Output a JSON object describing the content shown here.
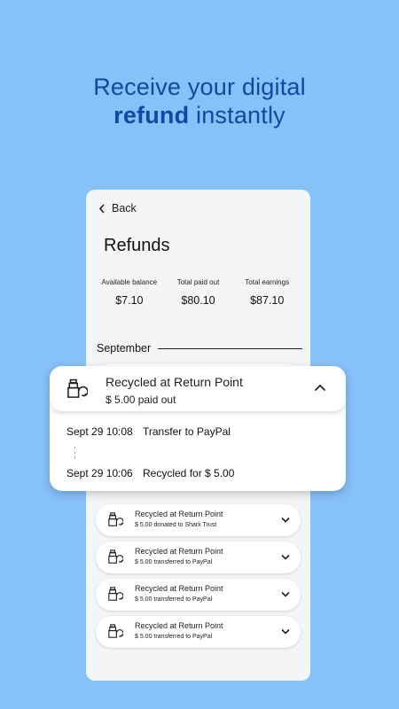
{
  "headline": {
    "line1": "Receive your digital",
    "strong": "refund",
    "rest": " instantly"
  },
  "app": {
    "back_label": "Back",
    "title": "Refunds",
    "stats": [
      {
        "label": "Available balance",
        "value": "$7.10"
      },
      {
        "label": "Total paid out",
        "value": "$80.10"
      },
      {
        "label": "Total earnings",
        "value": "$87.10"
      }
    ],
    "month": "September",
    "expanded": {
      "title": "Recycled at Return Point",
      "subtitle": "$ 5.00 paid out",
      "events": [
        {
          "date": "Sept 29 10:08",
          "text": "Transfer to PayPal"
        },
        {
          "date": "Sept 29 10:06",
          "text": "Recycled for $ 5.00"
        }
      ]
    },
    "items": [
      {
        "title": "Recycled at Return Point",
        "subtitle": "$ 5.00 donated to Shark Trust"
      },
      {
        "title": "Recycled at Return Point",
        "subtitle": "$ 5.00 transferred to PayPal"
      },
      {
        "title": "Recycled at Return Point",
        "subtitle": "$ 5.00 transferred to PayPal"
      },
      {
        "title": "Recycled at Return Point",
        "subtitle": "$ 5.00 transferred to PayPal"
      }
    ]
  },
  "icons": {
    "back": "chevron-left-icon",
    "recycle": "recycle-bottles-icon",
    "expand": "chevron-down-icon",
    "collapse": "chevron-up-icon"
  },
  "colors": {
    "background": "#86c1f8",
    "headline": "#0d4aa6"
  }
}
